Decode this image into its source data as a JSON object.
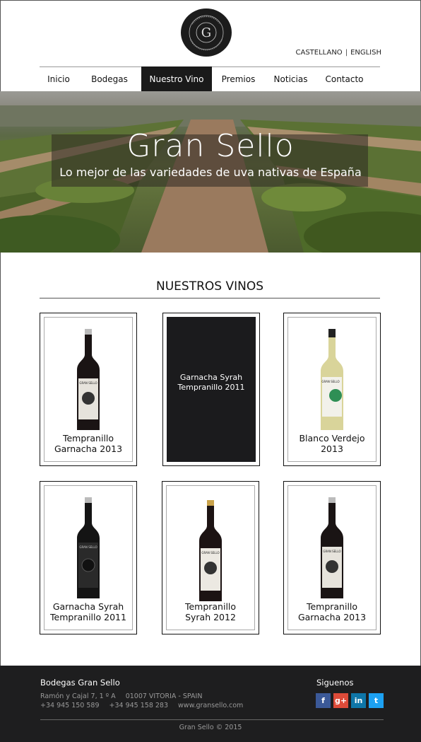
{
  "header": {
    "lang_primary": "CASTELLANO",
    "lang_sep": "|",
    "lang_secondary": "ENGLISH"
  },
  "nav": {
    "items": [
      {
        "label": "Inicio"
      },
      {
        "label": "Bodegas"
      },
      {
        "label": "Nuestro Vino"
      },
      {
        "label": "Premios"
      },
      {
        "label": "Noticias"
      },
      {
        "label": "Contacto"
      }
    ],
    "active_index": 2
  },
  "hero": {
    "title": "Gran Sello",
    "subtitle": "Lo mejor de las variedades de uva nativas de España"
  },
  "wines": {
    "section_title": "NUESTROS VINOS",
    "items": [
      {
        "name": "Tempranillo\nGarnacha 2013",
        "bottle": "red-wine-bottle"
      },
      {
        "name": "Garnacha Syrah\nTempranillo 2011",
        "bottle": "none"
      },
      {
        "name": "Blanco Verdejo\n2013",
        "bottle": "white-wine-bottle"
      },
      {
        "name": "Garnacha Syrah\nTempranillo 2011",
        "bottle": "black-label-bottle"
      },
      {
        "name": "Tempranillo\nSyrah 2012",
        "bottle": "red-wine-bottle-gold-cap"
      },
      {
        "name": "Tempranillo\nGarnacha 2013",
        "bottle": "red-wine-bottle"
      }
    ]
  },
  "footer": {
    "company": "Bodegas Gran Sello",
    "address": "Ramón y Cajal 7, 1 º A",
    "city": "01007 VITORIA - SPAIN",
    "phone1": "+34 945 150 589",
    "phone2": "+34 945 158 283",
    "website": "www.gransello.com",
    "follow": "Siguenos",
    "socials": [
      {
        "icon": "facebook-icon",
        "glyph": "f",
        "color": "#3b5998"
      },
      {
        "icon": "google-plus-icon",
        "glyph": "g+",
        "color": "#dd4b39"
      },
      {
        "icon": "linkedin-icon",
        "glyph": "in",
        "color": "#0e76a8"
      },
      {
        "icon": "twitter-icon",
        "glyph": "t",
        "color": "#1da1f2"
      }
    ],
    "copyright": "Gran Sello © 2015"
  }
}
